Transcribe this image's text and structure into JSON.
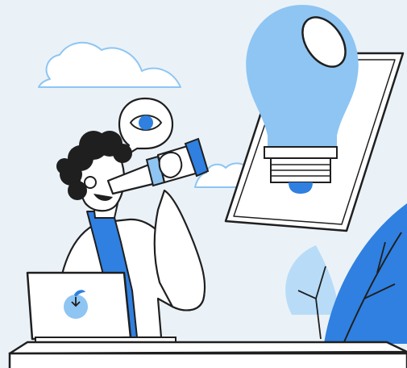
{
  "illustration": {
    "subject": "person-with-telescope-and-lightbulb",
    "icons": [
      "cloud-icon",
      "eye-icon",
      "lightbulb-icon",
      "telescope-icon",
      "laptop-icon",
      "apple-logo-icon",
      "leaf-icon",
      "plant-icon"
    ]
  },
  "colors": {
    "background": "#eaf2f8",
    "outline": "#1f1f1f",
    "brand_blue": "#2f80e0",
    "light_blue": "#8ec5f2",
    "pale_blue": "#b8dcf7",
    "white": "#ffffff"
  }
}
